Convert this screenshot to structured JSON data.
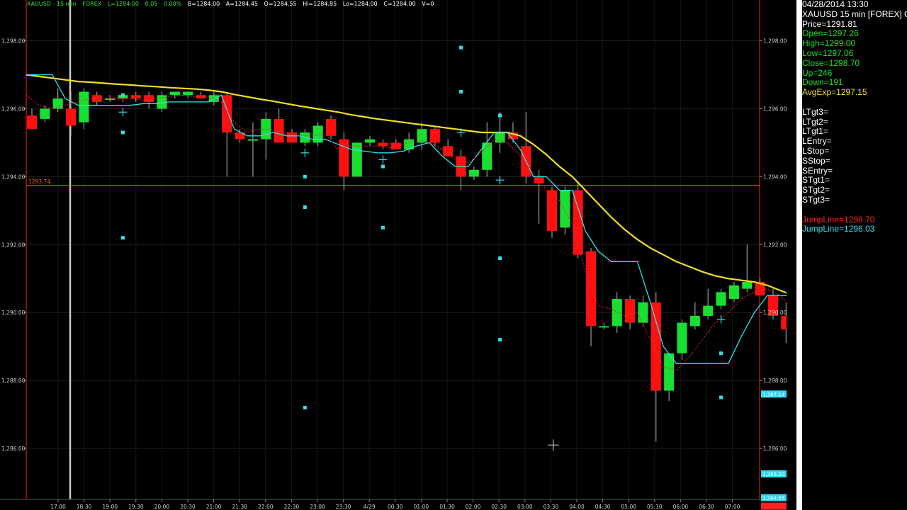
{
  "toolbar": {
    "symbol": "XAUUSD - 15 min",
    "market": "FOREX",
    "last": "L=1284.00",
    "change": "0.05",
    "change_pct": "0.00%",
    "bid": "B=1284.00",
    "ask": "A=1284.45",
    "open": "O=1284.55",
    "high": "Hi=1284.85",
    "low": "Lo=1284.00",
    "close": "C=1284.00",
    "volume": "V=0"
  },
  "info_panel": {
    "datetime": "04/28/2014 13:30",
    "instrument": "XAUUSD 15 min [FOREX] C",
    "price": "Price=1291.81",
    "open": "Open=1297.26",
    "high": "High=1299.00",
    "low": "Low=1297.06",
    "close": "Close=1298.70",
    "up": "Up=246",
    "down": "Down=191",
    "avgexp": "AvgExp=1297.15",
    "levels": [
      "LTgt3=",
      "LTgt2=",
      "LTgt1=",
      "LEntry=",
      "LStop=",
      "SStop=",
      "SEntry=",
      "STgt1=",
      "STgt2=",
      "STgt3="
    ],
    "jumpline_red": "JumpLine=1298.70",
    "jumpline_cyan": "JumpLine=1296.03"
  },
  "colors": {
    "background": "#000000",
    "up_candle": "#18e030",
    "down_candle": "#ff1010",
    "avg_line": "#f0e020",
    "jump_line": "#30e0f0",
    "stop_line": "#ff2020",
    "hline": "#ff6a20",
    "axis": "#ff2020",
    "grid": "#1e1e1e"
  },
  "chart_data": {
    "type": "candlestick",
    "title": "",
    "ylim": [
      1284.5,
      1299.2
    ],
    "yticks": [
      "1,298.00",
      "1,296.00",
      "1,294.00",
      "1,292.00",
      "1,290.00",
      "1,288.00",
      "1,286.00"
    ],
    "ytick_values": [
      1298,
      1296,
      1294,
      1292,
      1290,
      1288,
      1286
    ],
    "xticks": [
      "17:00",
      "18:30",
      "19:00",
      "19:30",
      "20:00",
      "20:30",
      "21:00",
      "21:30",
      "22:00",
      "22:30",
      "23:00",
      "23:30",
      "4/29",
      "00:30",
      "01:00",
      "01:30",
      "02:00",
      "02:30",
      "03:00",
      "03:30",
      "04:00",
      "04:30",
      "05:00",
      "05:30",
      "06:00",
      "06:30",
      "07:00"
    ],
    "horizontal_line": {
      "value": 1293.74,
      "label": "1293.74"
    },
    "right_markers": [
      {
        "value": 1287.6,
        "label": "1,287.14",
        "color": "#30d8f0"
      },
      {
        "value": 1285.25,
        "label": "1,285.20",
        "color": "#30d8f0"
      },
      {
        "value": 1284.55,
        "label": "1,284.55",
        "color": "#30d8f0"
      },
      {
        "value": 1284.3,
        "label": "",
        "color": "#ff2020"
      }
    ],
    "candles": [
      {
        "o": 1295.8,
        "h": 1296.0,
        "l": 1295.6,
        "c": 1295.4
      },
      {
        "o": 1295.7,
        "h": 1296.1,
        "l": 1295.6,
        "c": 1296.0
      },
      {
        "o": 1296.0,
        "h": 1296.6,
        "l": 1295.9,
        "c": 1296.3
      },
      {
        "o": 1296.0,
        "h": 1296.5,
        "l": 1295.2,
        "c": 1295.5
      },
      {
        "o": 1295.6,
        "h": 1296.6,
        "l": 1295.4,
        "c": 1296.5
      },
      {
        "o": 1296.4,
        "h": 1296.5,
        "l": 1296.1,
        "c": 1296.2
      },
      {
        "o": 1296.3,
        "h": 1296.4,
        "l": 1296.2,
        "c": 1296.3
      },
      {
        "o": 1296.3,
        "h": 1296.4,
        "l": 1296.2,
        "c": 1296.4
      },
      {
        "o": 1296.4,
        "h": 1296.5,
        "l": 1296.2,
        "c": 1296.3
      },
      {
        "o": 1296.4,
        "h": 1296.5,
        "l": 1296.0,
        "c": 1296.2
      },
      {
        "o": 1296.0,
        "h": 1296.5,
        "l": 1295.9,
        "c": 1296.4
      },
      {
        "o": 1296.4,
        "h": 1296.5,
        "l": 1296.3,
        "c": 1296.5
      },
      {
        "o": 1296.4,
        "h": 1296.5,
        "l": 1296.3,
        "c": 1296.5
      },
      {
        "o": 1296.4,
        "h": 1296.5,
        "l": 1296.3,
        "c": 1296.3
      },
      {
        "o": 1296.2,
        "h": 1296.5,
        "l": 1296.1,
        "c": 1296.4
      },
      {
        "o": 1296.4,
        "h": 1296.5,
        "l": 1294.0,
        "c": 1295.3
      },
      {
        "o": 1295.3,
        "h": 1295.4,
        "l": 1295.0,
        "c": 1295.1
      },
      {
        "o": 1295.1,
        "h": 1295.6,
        "l": 1294.0,
        "c": 1295.1
      },
      {
        "o": 1295.1,
        "h": 1295.9,
        "l": 1294.5,
        "c": 1295.7
      },
      {
        "o": 1295.7,
        "h": 1296.0,
        "l": 1295.0,
        "c": 1295.0
      },
      {
        "o": 1295.3,
        "h": 1295.4,
        "l": 1295.0,
        "c": 1295.0
      },
      {
        "o": 1295.0,
        "h": 1295.4,
        "l": 1294.9,
        "c": 1295.3
      },
      {
        "o": 1295.0,
        "h": 1295.6,
        "l": 1294.9,
        "c": 1295.5
      },
      {
        "o": 1295.7,
        "h": 1295.8,
        "l": 1295.1,
        "c": 1295.2
      },
      {
        "o": 1295.1,
        "h": 1295.3,
        "l": 1293.6,
        "c": 1294.0
      },
      {
        "o": 1294.0,
        "h": 1295.0,
        "l": 1294.0,
        "c": 1295.0
      },
      {
        "o": 1295.0,
        "h": 1295.2,
        "l": 1294.9,
        "c": 1295.1
      },
      {
        "o": 1295.0,
        "h": 1295.1,
        "l": 1294.8,
        "c": 1294.9
      },
      {
        "o": 1295.0,
        "h": 1295.1,
        "l": 1294.8,
        "c": 1294.8
      },
      {
        "o": 1294.8,
        "h": 1295.3,
        "l": 1294.7,
        "c": 1295.1
      },
      {
        "o": 1295.0,
        "h": 1295.6,
        "l": 1294.8,
        "c": 1295.4
      },
      {
        "o": 1295.4,
        "h": 1295.5,
        "l": 1294.9,
        "c": 1295.0
      },
      {
        "o": 1294.9,
        "h": 1295.1,
        "l": 1294.6,
        "c": 1294.6
      },
      {
        "o": 1294.6,
        "h": 1294.8,
        "l": 1293.6,
        "c": 1294.0
      },
      {
        "o": 1294.0,
        "h": 1294.3,
        "l": 1293.9,
        "c": 1294.2
      },
      {
        "o": 1294.2,
        "h": 1295.6,
        "l": 1294.0,
        "c": 1295.0
      },
      {
        "o": 1295.0,
        "h": 1295.9,
        "l": 1294.7,
        "c": 1295.3
      },
      {
        "o": 1295.3,
        "h": 1295.6,
        "l": 1295.0,
        "c": 1295.1
      },
      {
        "o": 1294.9,
        "h": 1295.9,
        "l": 1293.8,
        "c": 1294.0
      },
      {
        "o": 1294.0,
        "h": 1294.2,
        "l": 1292.6,
        "c": 1293.8
      },
      {
        "o": 1293.6,
        "h": 1293.7,
        "l": 1292.2,
        "c": 1292.4
      },
      {
        "o": 1292.5,
        "h": 1293.7,
        "l": 1292.3,
        "c": 1293.6
      },
      {
        "o": 1293.6,
        "h": 1293.8,
        "l": 1291.6,
        "c": 1291.7
      },
      {
        "o": 1291.8,
        "h": 1291.9,
        "l": 1289.0,
        "c": 1289.6
      },
      {
        "o": 1289.6,
        "h": 1289.7,
        "l": 1289.5,
        "c": 1289.6
      },
      {
        "o": 1289.6,
        "h": 1290.6,
        "l": 1289.4,
        "c": 1290.4
      },
      {
        "o": 1290.4,
        "h": 1290.5,
        "l": 1289.5,
        "c": 1289.7
      },
      {
        "o": 1289.7,
        "h": 1290.5,
        "l": 1289.6,
        "c": 1290.3
      },
      {
        "o": 1290.3,
        "h": 1290.6,
        "l": 1286.2,
        "c": 1287.7
      },
      {
        "o": 1287.7,
        "h": 1288.8,
        "l": 1287.4,
        "c": 1288.8
      },
      {
        "o": 1288.8,
        "h": 1289.8,
        "l": 1288.6,
        "c": 1289.7
      },
      {
        "o": 1289.6,
        "h": 1290.3,
        "l": 1289.5,
        "c": 1289.9
      },
      {
        "o": 1289.9,
        "h": 1290.7,
        "l": 1289.8,
        "c": 1290.2
      },
      {
        "o": 1290.2,
        "h": 1290.7,
        "l": 1290.1,
        "c": 1290.6
      },
      {
        "o": 1290.4,
        "h": 1290.9,
        "l": 1290.3,
        "c": 1290.8
      },
      {
        "o": 1290.7,
        "h": 1292.0,
        "l": 1290.6,
        "c": 1290.9
      },
      {
        "o": 1290.9,
        "h": 1291.0,
        "l": 1290.5,
        "c": 1290.5
      },
      {
        "o": 1290.5,
        "h": 1290.7,
        "l": 1289.8,
        "c": 1289.9
      },
      {
        "o": 1289.9,
        "h": 1290.3,
        "l": 1289.1,
        "c": 1289.5
      },
      {
        "o": 1289.5,
        "h": 1290.5,
        "l": 1289.4,
        "c": 1290.3
      }
    ],
    "avg_line": [
      1297.0,
      1296.95,
      1296.9,
      1296.85,
      1296.8,
      1296.78,
      1296.75,
      1296.72,
      1296.7,
      1296.67,
      1296.65,
      1296.62,
      1296.6,
      1296.58,
      1296.55,
      1296.5,
      1296.42,
      1296.35,
      1296.28,
      1296.22,
      1296.15,
      1296.08,
      1296.02,
      1295.96,
      1295.9,
      1295.82,
      1295.76,
      1295.7,
      1295.65,
      1295.6,
      1295.55,
      1295.5,
      1295.45,
      1295.4,
      1295.35,
      1295.3,
      1295.3,
      1295.3,
      1295.2,
      1294.95,
      1294.65,
      1294.3,
      1294.0,
      1293.6,
      1293.2,
      1292.8,
      1292.45,
      1292.15,
      1291.9,
      1291.7,
      1291.5,
      1291.35,
      1291.2,
      1291.08,
      1291.0,
      1290.95,
      1290.9,
      1290.8,
      1290.65,
      1290.5
    ],
    "jump_line": [
      1297.0,
      1297.0,
      1297.0,
      1296.3,
      1296.1,
      1296.1,
      1296.1,
      1296.1,
      1296.1,
      1296.15,
      1296.15,
      1296.2,
      1296.2,
      1296.2,
      1296.2,
      1296.4,
      1295.4,
      1295.2,
      1295.2,
      1295.3,
      1295.2,
      1295.2,
      1295.1,
      1295.1,
      1294.95,
      1294.8,
      1294.75,
      1294.7,
      1294.7,
      1294.75,
      1294.9,
      1295.0,
      1294.6,
      1294.3,
      1294.3,
      1294.8,
      1295.3,
      1295.3,
      1294.8,
      1294.0,
      1294.0,
      1293.6,
      1293.6,
      1292.4,
      1291.8,
      1291.5,
      1291.5,
      1291.5,
      1290.3,
      1289.0,
      1288.5,
      1288.5,
      1288.5,
      1288.5,
      1288.5,
      1289.3,
      1290.0,
      1290.5,
      1290.5,
      1290.5
    ],
    "stop_line": [
      1296.4,
      1296.1,
      1296.0,
      1296.1,
      1296.2,
      1296.3,
      1296.3,
      1296.3,
      1296.3,
      1296.25,
      1296.3,
      1296.35,
      1296.4,
      1296.35,
      1296.35,
      1296.2,
      1295.6,
      1295.3,
      1295.4,
      1295.4,
      1295.25,
      1295.2,
      1295.2,
      1295.25,
      1294.8,
      1294.9,
      1294.9,
      1294.9,
      1294.85,
      1294.95,
      1295.1,
      1295.0,
      1294.8,
      1294.5,
      1294.4,
      1294.7,
      1295.1,
      1295.0,
      1294.6,
      1294.1,
      1293.6,
      1293.3,
      1292.6,
      1291.2,
      1290.2,
      1290.1,
      1289.9,
      1290.0,
      1289.2,
      1288.4,
      1288.3,
      1288.7,
      1289.2,
      1289.7,
      1290.0,
      1290.4,
      1290.6,
      1290.7,
      1290.5,
      1290.0
    ],
    "dots": [
      {
        "i": 7,
        "v": 1296.4
      },
      {
        "i": 7,
        "v": 1295.3
      },
      {
        "i": 7,
        "v": 1292.2
      },
      {
        "i": 21,
        "v": 1294.0
      },
      {
        "i": 21,
        "v": 1293.1
      },
      {
        "i": 21,
        "v": 1287.2
      },
      {
        "i": 27,
        "v": 1294.3
      },
      {
        "i": 27,
        "v": 1292.5
      },
      {
        "i": 33,
        "v": 1297.8
      },
      {
        "i": 33,
        "v": 1296.5
      },
      {
        "i": 36,
        "v": 1295.8
      },
      {
        "i": 36,
        "v": 1291.6
      },
      {
        "i": 36,
        "v": 1289.2
      },
      {
        "i": 53,
        "v": 1288.8
      },
      {
        "i": 53,
        "v": 1287.5
      }
    ],
    "crosses": [
      {
        "i": 7,
        "v": 1295.9
      },
      {
        "i": 21,
        "v": 1294.7
      },
      {
        "i": 27,
        "v": 1294.5
      },
      {
        "i": 33,
        "v": 1295.3
      },
      {
        "i": 36,
        "v": 1293.9
      },
      {
        "i": 53,
        "v": 1289.8
      }
    ],
    "cursor": {
      "x_index": 40.1,
      "value": 1286.1
    }
  }
}
